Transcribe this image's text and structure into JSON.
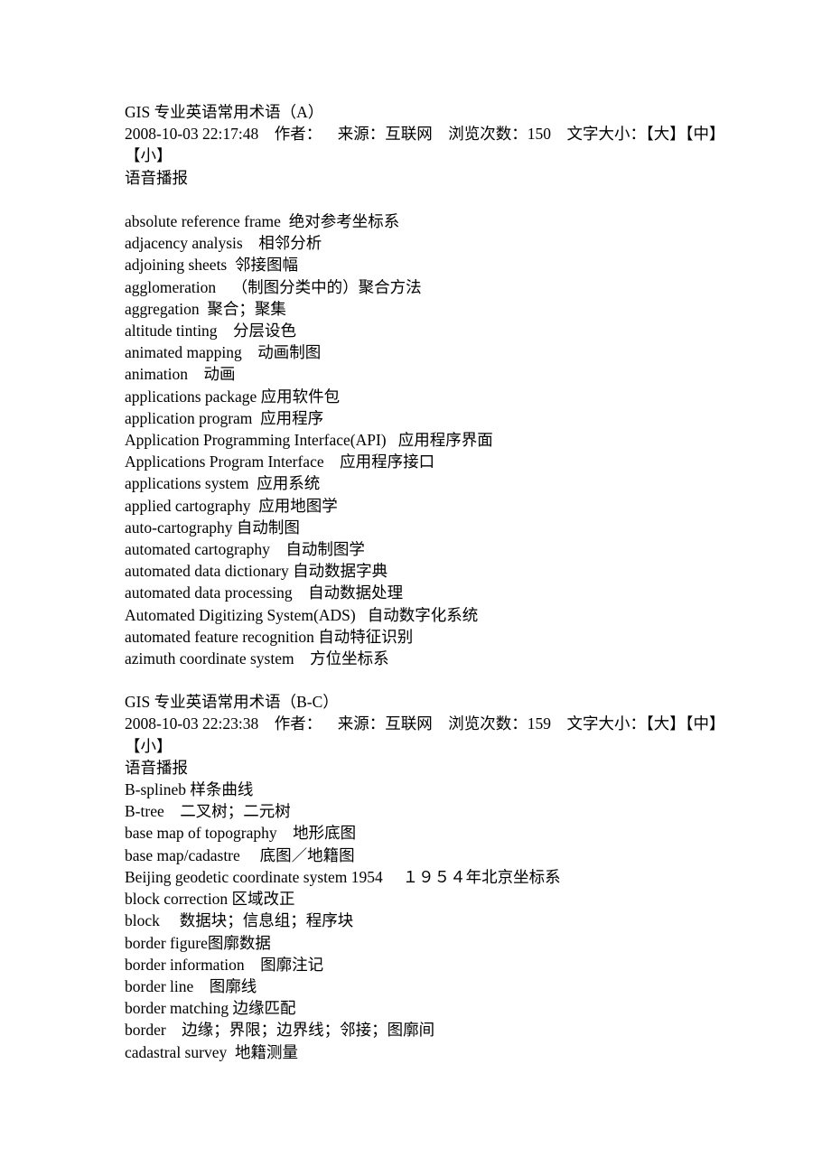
{
  "document": {
    "background_color": "#ffffff",
    "text_color": "#000000"
  },
  "articles": [
    {
      "title": "GIS 专业英语常用术语（A）",
      "meta": {
        "timestamp": "2008-10-03 22:17:48",
        "author_label": "作者：",
        "source_label": "来源：",
        "source_value": "互联网",
        "views_label": "浏览次数：",
        "views_value": "150",
        "font_size_label": "文字大小：",
        "font_size_large": "【大】",
        "font_size_medium": "【中】",
        "font_size_small": "【小】",
        "full_text": "2008-10-03 22:17:48    作者：    来源：互联网    浏览次数：150    文字大小：【大】【中】【小】"
      },
      "audio_label": "语音播报",
      "blank_line_before_terms": true,
      "terms": [
        "absolute reference frame  绝对参考坐标系",
        "adjacency analysis    相邻分析",
        "adjoining sheets  邻接图幅",
        "agglomeration    （制图分类中的）聚合方法",
        "aggregation  聚合；聚集",
        "altitude tinting    分层设色",
        "animated mapping    动画制图",
        "animation    动画",
        "applications package 应用软件包",
        "application program  应用程序",
        "Application Programming Interface(API)   应用程序界面",
        "Applications Program Interface    应用程序接口",
        "applications system  应用系统",
        "applied cartography  应用地图学",
        "auto-cartography 自动制图",
        "automated cartography    自动制图学",
        "automated data dictionary 自动数据字典",
        "automated data processing    自动数据处理",
        "Automated Digitizing System(ADS)   自动数字化系统",
        "automated feature recognition 自动特征识别",
        "azimuth coordinate system    方位坐标系"
      ]
    },
    {
      "title": "GIS 专业英语常用术语（B-C）",
      "meta": {
        "timestamp": "2008-10-03 22:23:38",
        "author_label": "作者：",
        "source_label": "来源：",
        "source_value": "互联网",
        "views_label": "浏览次数：",
        "views_value": "159",
        "font_size_label": "文字大小：",
        "font_size_large": "【大】",
        "font_size_medium": "【中】",
        "font_size_small": "【小】",
        "full_text": "2008-10-03 22:23:38    作者：    来源：互联网    浏览次数：159    文字大小：【大】【中】【小】"
      },
      "audio_label": "语音播报",
      "blank_line_before_terms": false,
      "terms": [
        "B-splineb 样条曲线",
        "B-tree    二叉树；二元树",
        "base map of topography    地形底图",
        "base map/cadastre     底图／地籍图",
        "Beijing geodetic coordinate system 1954     １９５４年北京坐标系",
        "block correction 区域改正",
        "block     数据块；信息组；程序块",
        "border figure图廓数据",
        "border information    图廓注记",
        "border line    图廓线",
        "border matching 边缘匹配",
        "border    边缘；界限；边界线；邻接；图廓间",
        "cadastral survey  地籍测量"
      ]
    }
  ]
}
